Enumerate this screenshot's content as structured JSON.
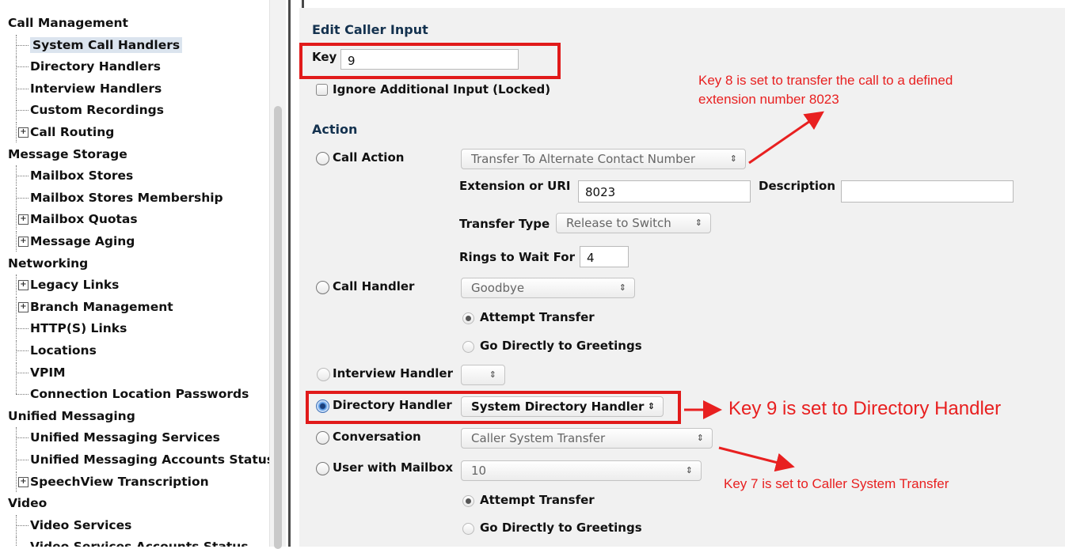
{
  "nav": {
    "items": [
      {
        "kind": "section",
        "label": "Call Management"
      },
      {
        "kind": "child",
        "label": "System Call Handlers",
        "selected": true
      },
      {
        "kind": "child",
        "label": "Directory Handlers"
      },
      {
        "kind": "child",
        "label": "Interview Handlers"
      },
      {
        "kind": "child",
        "label": "Custom Recordings"
      },
      {
        "kind": "expandable",
        "label": "Call Routing",
        "expander": "+"
      },
      {
        "kind": "section",
        "label": "Message Storage"
      },
      {
        "kind": "child",
        "label": "Mailbox Stores"
      },
      {
        "kind": "child",
        "label": "Mailbox Stores Membership"
      },
      {
        "kind": "expandable",
        "label": "Mailbox Quotas",
        "expander": "+"
      },
      {
        "kind": "expandable",
        "label": "Message Aging",
        "expander": "+"
      },
      {
        "kind": "section",
        "label": "Networking"
      },
      {
        "kind": "expandable",
        "label": "Legacy Links",
        "expander": "+"
      },
      {
        "kind": "expandable",
        "label": "Branch Management",
        "expander": "+"
      },
      {
        "kind": "child",
        "label": "HTTP(S) Links"
      },
      {
        "kind": "child",
        "label": "Locations"
      },
      {
        "kind": "child",
        "label": "VPIM"
      },
      {
        "kind": "child",
        "label": "Connection Location Passwords",
        "last": true
      },
      {
        "kind": "section",
        "label": "Unified Messaging"
      },
      {
        "kind": "child",
        "label": "Unified Messaging Services"
      },
      {
        "kind": "child",
        "label": "Unified Messaging Accounts Status"
      },
      {
        "kind": "expandable",
        "label": "SpeechView Transcription",
        "expander": "+"
      },
      {
        "kind": "section",
        "label": "Video"
      },
      {
        "kind": "child",
        "label": "Video Services"
      },
      {
        "kind": "child",
        "label": "Video Services Accounts Status"
      }
    ]
  },
  "form": {
    "title": "Edit Caller Input",
    "key_label": "Key",
    "key_value": "9",
    "ignore_label": "Ignore Additional Input (Locked)",
    "action_heading": "Action",
    "call_action": {
      "label": "Call Action",
      "select": "Transfer To Alternate Contact Number",
      "ext_label": "Extension or URI",
      "ext_value": "8023",
      "desc_label": "Description",
      "desc_value": "",
      "transfer_type_label": "Transfer Type",
      "transfer_type": "Release to Switch",
      "rings_label": "Rings to Wait For",
      "rings_value": "4"
    },
    "call_handler": {
      "label": "Call Handler",
      "select": "Goodbye",
      "opt1": "Attempt Transfer",
      "opt2": "Go Directly to Greetings"
    },
    "interview_handler": {
      "label": "Interview Handler",
      "select": ""
    },
    "directory_handler": {
      "label": "Directory Handler",
      "select": "System Directory Handler"
    },
    "conversation": {
      "label": "Conversation",
      "select": "Caller System Transfer"
    },
    "user_mailbox": {
      "label": "User with Mailbox",
      "select": "10",
      "opt1": "Attempt Transfer",
      "opt2": "Go Directly to Greetings"
    }
  },
  "annotations": {
    "key8_line1": "Key 8 is set to transfer the call to a defined",
    "key8_line2": "extension number 8023",
    "key9": "Key 9 is set to Directory Handler",
    "key7": "Key 7 is set to Caller System Transfer"
  },
  "colors": {
    "annotation_red": "#e82020",
    "heading_navy": "#14324f",
    "selected_radio_blue": "#4a90e2"
  }
}
